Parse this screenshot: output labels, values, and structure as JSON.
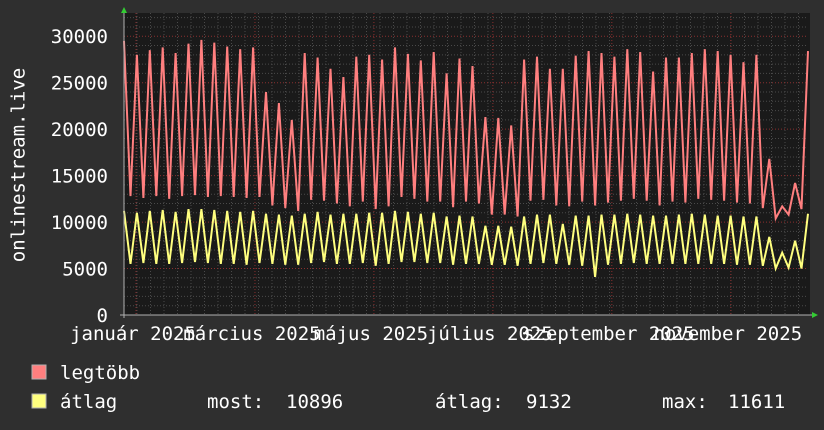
{
  "chart_data": {
    "type": "line",
    "title": "",
    "xlabel": "",
    "ylabel": "onlinestream.live",
    "ylim": [
      0,
      32500
    ],
    "y_ticks": [
      0,
      5000,
      10000,
      15000,
      20000,
      25000,
      30000
    ],
    "y_tick_labels": [
      "0",
      "5000",
      "10000",
      "15000",
      "20000",
      "25000",
      "30000"
    ],
    "x_tick_labels": [
      "január 2025",
      "március 2025",
      "május 2025",
      "július 2025",
      "szeptember 2025",
      "november 2025"
    ],
    "grid": true,
    "legend_position": "bottom-left",
    "colors": {
      "max_series": "#ff7f7f",
      "avg_series": "#ffff7f",
      "background": "#2f2f2f",
      "plot_bg": "#1a1a1a",
      "grid_major": "#8a2f2f",
      "grid_minor": "#4a4a4a",
      "axis": "#b0b0b0",
      "arrow": "#33cc33"
    },
    "series": [
      {
        "name": "legtöbb",
        "values": [
          29500,
          12800,
          28000,
          12600,
          28500,
          12800,
          28800,
          12500,
          28200,
          12800,
          29200,
          12900,
          29600,
          12700,
          29300,
          12800,
          28900,
          12700,
          28600,
          12600,
          28800,
          12700,
          24000,
          11800,
          22800,
          11500,
          21000,
          11200,
          28200,
          12400,
          27700,
          12300,
          26500,
          12000,
          25600,
          11700,
          27800,
          12200,
          28000,
          11400,
          27500,
          11700,
          28800,
          12700,
          28100,
          12500,
          27400,
          12200,
          28300,
          12200,
          26000,
          11600,
          27600,
          12200,
          26800,
          12000,
          21300,
          10800,
          21200,
          10800,
          20400,
          10600,
          27500,
          12300,
          27800,
          12400,
          26500,
          11800,
          26500,
          11700,
          27900,
          12200,
          28400,
          11800,
          28200,
          12100,
          27800,
          12300,
          28600,
          12500,
          28300,
          12300,
          26200,
          11800,
          27700,
          12200,
          27700,
          12100,
          28200,
          12500,
          28600,
          12400,
          28400,
          12300,
          28000,
          12100,
          27200,
          12000,
          28000,
          11500,
          16800,
          10400,
          11700,
          10800,
          14200,
          11400,
          28400
        ]
      },
      {
        "name": "átlag",
        "values": [
          11200,
          5500,
          11000,
          5600,
          11200,
          5500,
          11300,
          5500,
          11100,
          5600,
          11400,
          5700,
          11400,
          5600,
          11300,
          5500,
          11200,
          5500,
          11100,
          5400,
          11200,
          5600,
          10900,
          5500,
          10800,
          5400,
          10700,
          5400,
          10900,
          5600,
          11100,
          5700,
          10800,
          5500,
          10900,
          5500,
          10900,
          5600,
          11000,
          5300,
          11000,
          5500,
          11200,
          5700,
          11100,
          5700,
          10900,
          5600,
          11000,
          5600,
          10600,
          5400,
          10700,
          5500,
          10600,
          5500,
          9600,
          5400,
          9600,
          5400,
          9500,
          5300,
          10600,
          5500,
          10800,
          5600,
          10800,
          5500,
          9800,
          5400,
          10700,
          5300,
          10700,
          4100,
          10800,
          5400,
          10800,
          5500,
          10900,
          5600,
          10800,
          5500,
          10700,
          5500,
          10700,
          5500,
          10800,
          5500,
          10900,
          5500,
          10800,
          5500,
          10700,
          5500,
          10700,
          5400,
          10600,
          5400,
          10600,
          5300,
          8400,
          5000,
          6700,
          5100,
          8000,
          5000,
          10900
        ]
      }
    ],
    "legend": {
      "max_label": "legtöbb",
      "avg_label": "átlag",
      "stats": [
        {
          "label": "most:",
          "value": "10896"
        },
        {
          "label": "átlag:",
          "value": "9132"
        },
        {
          "label": "max:",
          "value": "11611"
        }
      ]
    }
  }
}
